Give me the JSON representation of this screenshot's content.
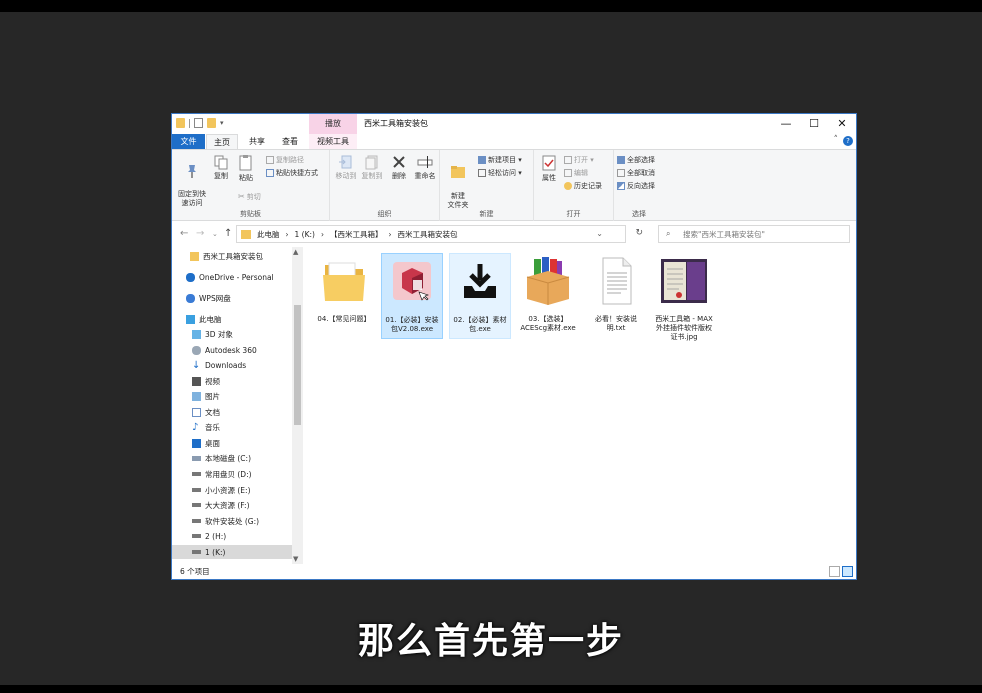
{
  "subtitle": "那么首先第一步",
  "window": {
    "title": "西米工具箱安装包",
    "context_tab": "播放",
    "controls": {
      "minimize": "—",
      "maximize": "☐",
      "close": "✕"
    }
  },
  "tabs": {
    "file": "文件",
    "home": "主页",
    "share": "共享",
    "view": "查看",
    "video_tools": "视频工具"
  },
  "ribbon": {
    "clipboard": {
      "label": "剪贴板",
      "pin": "固定到快\n速访问",
      "copy": "复制",
      "paste": "粘贴",
      "copy_path": "复制路径",
      "paste_shortcut": "粘贴快捷方式",
      "cut": "剪切"
    },
    "organize": {
      "label": "组织",
      "move_to": "移动到",
      "copy_to": "复制到",
      "delete": "删除",
      "rename": "重命名"
    },
    "new": {
      "label": "新建",
      "new_folder": "新建\n文件夹",
      "new_item": "新建项目 ▾",
      "easy_access": "轻松访问 ▾"
    },
    "open": {
      "label": "打开",
      "properties": "属性",
      "open": "打开 ▾",
      "edit": "编辑",
      "history": "历史记录"
    },
    "select": {
      "label": "选择",
      "select_all": "全部选择",
      "select_none": "全部取消",
      "invert": "反向选择"
    }
  },
  "nav": {
    "breadcrumbs": [
      "此电脑",
      "›",
      "1 (K:)",
      "›",
      "【西米工具箱】",
      "›",
      "西米工具箱安装包"
    ],
    "search_placeholder": "搜索\"西米工具箱安装包\""
  },
  "sidebar": [
    {
      "label": "西米工具箱安装包",
      "icon": "folder-icon"
    },
    {
      "label": "OneDrive - Personal",
      "icon": "cloud-icon"
    },
    {
      "label": "WPS网盘",
      "icon": "cloud-icon"
    },
    {
      "label": "此电脑",
      "icon": "computer-icon"
    },
    {
      "label": "3D 对象",
      "icon": "cube-icon"
    },
    {
      "label": "Autodesk 360",
      "icon": "cloud-icon"
    },
    {
      "label": "Downloads",
      "icon": "download-icon"
    },
    {
      "label": "视频",
      "icon": "video-icon"
    },
    {
      "label": "图片",
      "icon": "picture-icon"
    },
    {
      "label": "文档",
      "icon": "document-icon"
    },
    {
      "label": "音乐",
      "icon": "music-icon"
    },
    {
      "label": "桌面",
      "icon": "desktop-icon"
    },
    {
      "label": "本地磁盘 (C:)",
      "icon": "drive-icon"
    },
    {
      "label": "常用盘贝 (D:)",
      "icon": "drive-icon"
    },
    {
      "label": "小小资源 (E:)",
      "icon": "drive-icon"
    },
    {
      "label": "大大资源 (F:)",
      "icon": "drive-icon"
    },
    {
      "label": "软件安装处 (G:)",
      "icon": "drive-icon"
    },
    {
      "label": "2 (H:)",
      "icon": "drive-icon"
    },
    {
      "label": "1 (K:)",
      "icon": "drive-icon"
    }
  ],
  "files": [
    {
      "name": "04.【常见问题】",
      "icon": "folder-icon"
    },
    {
      "name": "01.【必装】安装包V2.08.exe",
      "icon": "installer-box-icon"
    },
    {
      "name": "02.【必装】素材包.exe",
      "icon": "download-tray-icon"
    },
    {
      "name": "03.【选装】ACEScg素材.exe",
      "icon": "package-box-icon"
    },
    {
      "name": "必看！安装说明.txt",
      "icon": "text-file-icon"
    },
    {
      "name": "西米工具箱 - MAX外挂插件软件版权证书.jpg",
      "icon": "image-file-icon"
    }
  ],
  "status": {
    "count": "6 个项目"
  },
  "colors": {
    "accent": "#1e6ec8",
    "selection": "#cce8ff",
    "context_tab": "#f8d3e7"
  }
}
